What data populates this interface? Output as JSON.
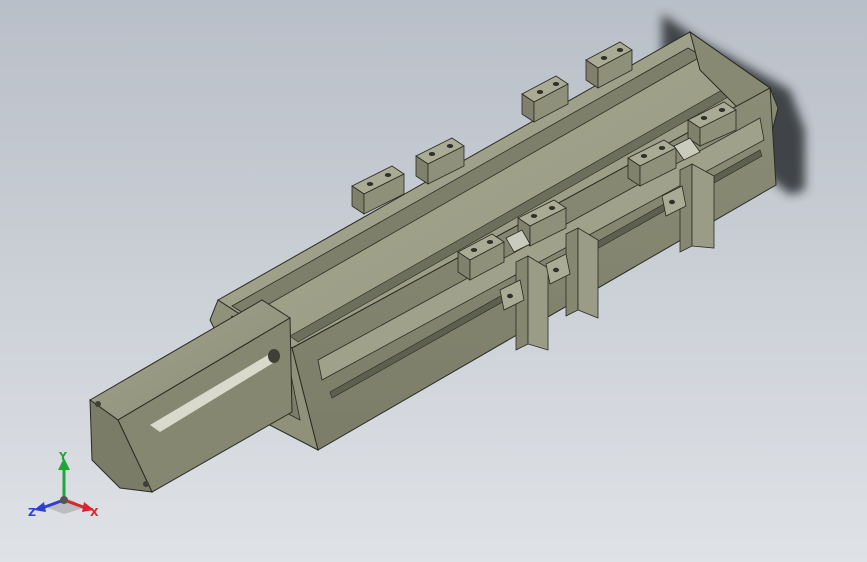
{
  "triad": {
    "x_label": "X",
    "y_label": "Y",
    "z_label": "Z"
  },
  "colors": {
    "background_top": "#b9bfc8",
    "background_bottom": "#dfe2e6",
    "body_light": "#9c9e87",
    "body_mid": "#8b8d77",
    "body_dark": "#6d6f5d",
    "axis_x": "#d8262e",
    "axis_y": "#21a53b",
    "axis_z": "#2f3fd6"
  }
}
